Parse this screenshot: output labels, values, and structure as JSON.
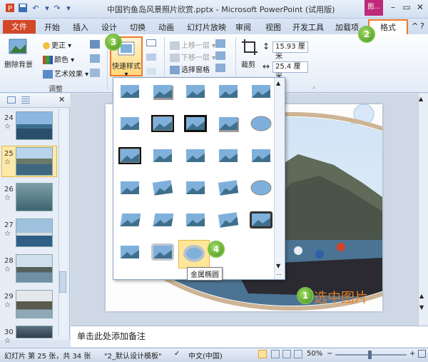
{
  "window": {
    "title": "中国钓鱼岛风景照片欣赏.pptx - Microsoft PowerPoint (试用版)",
    "context_tab_label": "图...",
    "minimize": "–",
    "restore": "▭",
    "close": "✕"
  },
  "quick_access": {
    "save_icon": "save-icon",
    "undo": "↶",
    "redo": "↷",
    "customize": "▾"
  },
  "tabs": {
    "file": "文件",
    "items": [
      "开始",
      "插入",
      "设计",
      "切换",
      "动画",
      "幻灯片放映",
      "审阅",
      "视图",
      "开发工具",
      "加载项"
    ],
    "format": "格式",
    "collapse": "^",
    "help": "?"
  },
  "ribbon": {
    "remove_bg": "删除背景",
    "correct": "更正",
    "color": "颜色",
    "artistic": "艺术效果",
    "adjust_group": "调整",
    "quick_styles": "快速样式",
    "bring_forward": "上移一层",
    "send_backward": "下移一层",
    "selection_pane": "选择窗格",
    "crop": "裁剪",
    "height_value": "15.93 厘米",
    "width_value": "25.4 厘米"
  },
  "slides": {
    "numbers": [
      "24",
      "25",
      "26",
      "27",
      "28",
      "29",
      "30"
    ],
    "star": "☆"
  },
  "slide": {
    "caption": "选中图片"
  },
  "gallery": {
    "tooltip": "金属椭圆"
  },
  "badges": [
    "1",
    "2",
    "3",
    "4"
  ],
  "notes": {
    "placeholder": "单击此处添加备注"
  },
  "status": {
    "slide_info": "幻灯片 第 25 张，共 34 张",
    "theme": "\"2_默认设计模板\"",
    "language": "中文(中国)",
    "zoom": "50%"
  },
  "colors": {
    "accent": "#ef7a2b",
    "file_tab": "#d24726",
    "badge": "#5fae2a"
  }
}
